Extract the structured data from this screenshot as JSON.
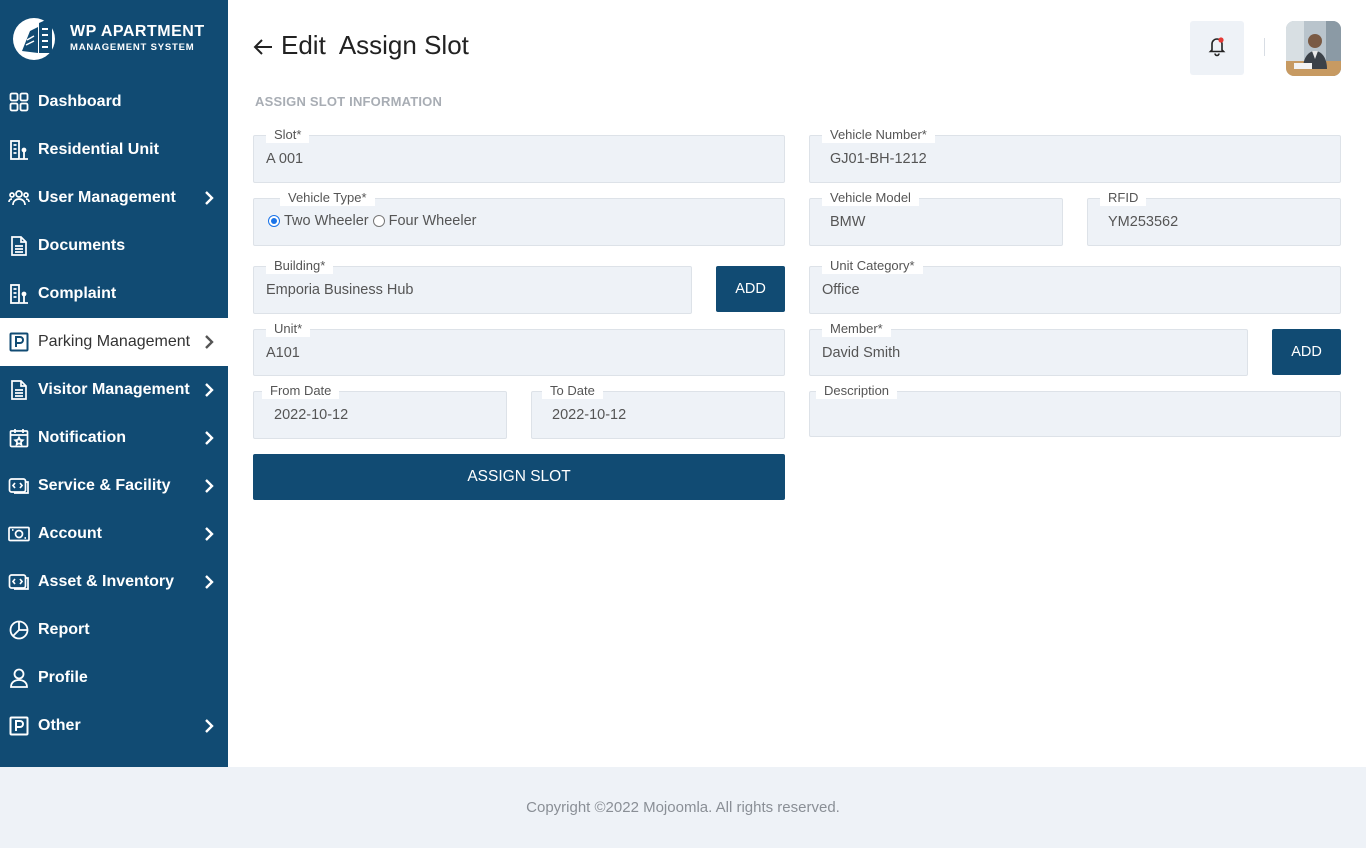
{
  "brand": {
    "title": "WP APARTMENT",
    "subtitle": "MANAGEMENT SYSTEM"
  },
  "sidebar": {
    "items": [
      {
        "label": "Dashboard",
        "icon": "dashboard-grid-icon",
        "has_submenu": false,
        "active": false
      },
      {
        "label": "Residential Unit",
        "icon": "building-icon",
        "has_submenu": false,
        "active": false
      },
      {
        "label": "User Management",
        "icon": "users-icon",
        "has_submenu": true,
        "active": false
      },
      {
        "label": "Documents",
        "icon": "document-icon",
        "has_submenu": false,
        "active": false
      },
      {
        "label": "Complaint",
        "icon": "building-icon",
        "has_submenu": false,
        "active": false
      },
      {
        "label": "Parking Management",
        "icon": "parking-icon",
        "has_submenu": true,
        "active": true
      },
      {
        "label": "Visitor Management",
        "icon": "document-icon",
        "has_submenu": true,
        "active": false
      },
      {
        "label": "Notification",
        "icon": "calendar-star-icon",
        "has_submenu": true,
        "active": false
      },
      {
        "label": "Service & Facility",
        "icon": "service-icon",
        "has_submenu": true,
        "active": false
      },
      {
        "label": "Account",
        "icon": "money-icon",
        "has_submenu": true,
        "active": false
      },
      {
        "label": "Asset & Inventory",
        "icon": "service-icon",
        "has_submenu": true,
        "active": false
      },
      {
        "label": "Report",
        "icon": "pie-chart-icon",
        "has_submenu": false,
        "active": false
      },
      {
        "label": "Profile",
        "icon": "person-icon",
        "has_submenu": false,
        "active": false
      },
      {
        "label": "Other",
        "icon": "parking-icon",
        "has_submenu": true,
        "active": false
      }
    ]
  },
  "header": {
    "title": "Edit  Assign Slot",
    "notification_dot_color": "#e53935"
  },
  "form": {
    "section_title": "ASSIGN SLOT INFORMATION",
    "slot": {
      "label": "Slot*",
      "value": "A 001"
    },
    "vehicle_number": {
      "label": "Vehicle Number*",
      "value": "GJ01-BH-1212"
    },
    "vehicle_type": {
      "label": "Vehicle Type*",
      "options": [
        "Two Wheeler",
        "Four Wheeler"
      ],
      "selected": "Two Wheeler"
    },
    "vehicle_model": {
      "label": "Vehicle Model",
      "value": "BMW"
    },
    "rfid": {
      "label": "RFID",
      "value": "YM253562"
    },
    "building": {
      "label": "Building*",
      "value": "Emporia Business Hub"
    },
    "building_add": "ADD",
    "unit_category": {
      "label": "Unit Category*",
      "value": "Office"
    },
    "unit": {
      "label": "Unit*",
      "value": "A101"
    },
    "member": {
      "label": "Member*",
      "value": "David Smith"
    },
    "member_add": "ADD",
    "from_date": {
      "label": "From Date",
      "value": "2022-10-12"
    },
    "to_date": {
      "label": "To Date",
      "value": "2022-10-12"
    },
    "description": {
      "label": "Description",
      "value": ""
    },
    "submit": "ASSIGN SLOT"
  },
  "footer": {
    "text": "Copyright ©2022 Mojoomla. All rights reserved."
  },
  "colors": {
    "primary": "#114b73",
    "field_bg": "#eef2f7",
    "footer_bg": "#eef2f7"
  }
}
